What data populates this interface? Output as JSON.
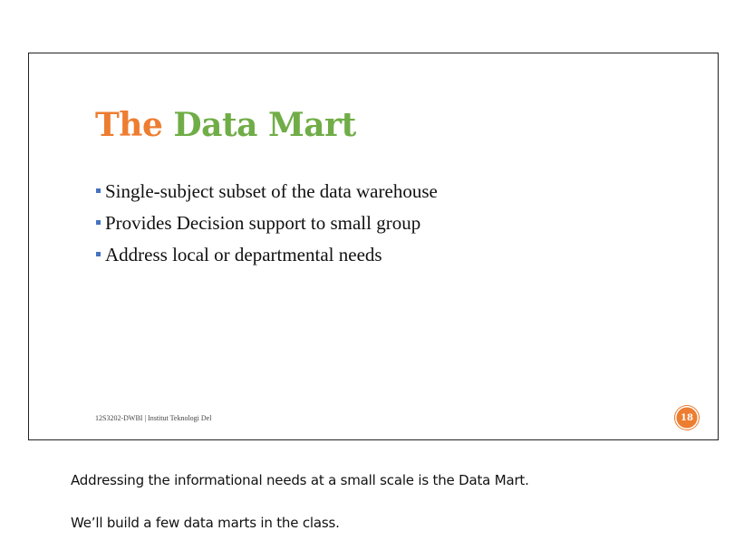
{
  "slide": {
    "title_part1": "The",
    "title_part2": "Data Mart",
    "bullets": [
      "Single-subject subset of the data warehouse",
      "Provides Decision support to small group",
      "Address local or departmental needs"
    ],
    "footer": "12S3202-DWBI | Institut Teknologi Del",
    "page_number": "18",
    "colors": {
      "orange": "#ed7d31",
      "green": "#70ad47",
      "bullet": "#4472c4"
    }
  },
  "notes": [
    "Addressing the informational needs at a small scale is the Data Mart.",
    "We’ll build a few data marts in the class."
  ]
}
